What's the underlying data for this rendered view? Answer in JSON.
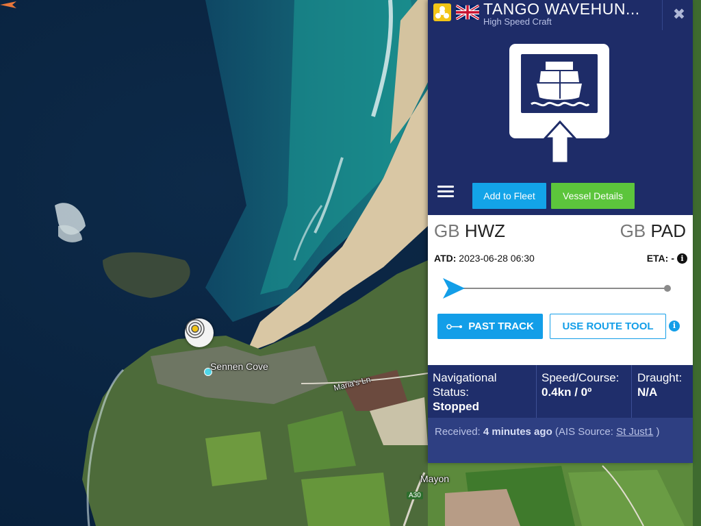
{
  "map": {
    "labels": {
      "sennen": "Sennen Cove",
      "maria": "Maria's Ln",
      "mayon": "Mayon",
      "road": "A30"
    }
  },
  "panel": {
    "name": "TANGO WAVEHUN...",
    "type": "High Speed Craft",
    "close": "✖",
    "flag_country": "GB",
    "buttons": {
      "add_fleet": "Add to Fleet",
      "vessel_details": "Vessel Details",
      "past_track": "PAST TRACK",
      "route_tool": "USE ROUTE TOOL"
    },
    "route": {
      "from_country": "GB",
      "from_port": "HWZ",
      "to_country": "GB",
      "to_port": "PAD",
      "atd_label": "ATD:",
      "atd_value": "2023-06-28 06:30",
      "eta_label": "ETA:",
      "eta_value": "-",
      "progress": 0
    },
    "stats": {
      "nav_label": "Navigational Status:",
      "nav_value": "Stopped",
      "speed_label": "Speed/Course:",
      "speed_value": "0.4kn / 0º",
      "draught_label": "Draught:",
      "draught_value": "N/A"
    },
    "received": {
      "label": "Received:",
      "value": "4 minutes ago",
      "source_prefix": "(AIS Source:",
      "source": "St Just1",
      "suffix": ")"
    }
  },
  "colors": {
    "panel_bg": "#1f2e6b",
    "accent_blue": "#139ee8",
    "accent_green": "#5cc53c",
    "logo_yellow": "#f2c417"
  },
  "icons": [
    "app-logo-icon",
    "uk-flag-icon",
    "close-icon",
    "passenger-ship-icon",
    "menu-icon",
    "info-icon",
    "track-icon"
  ]
}
